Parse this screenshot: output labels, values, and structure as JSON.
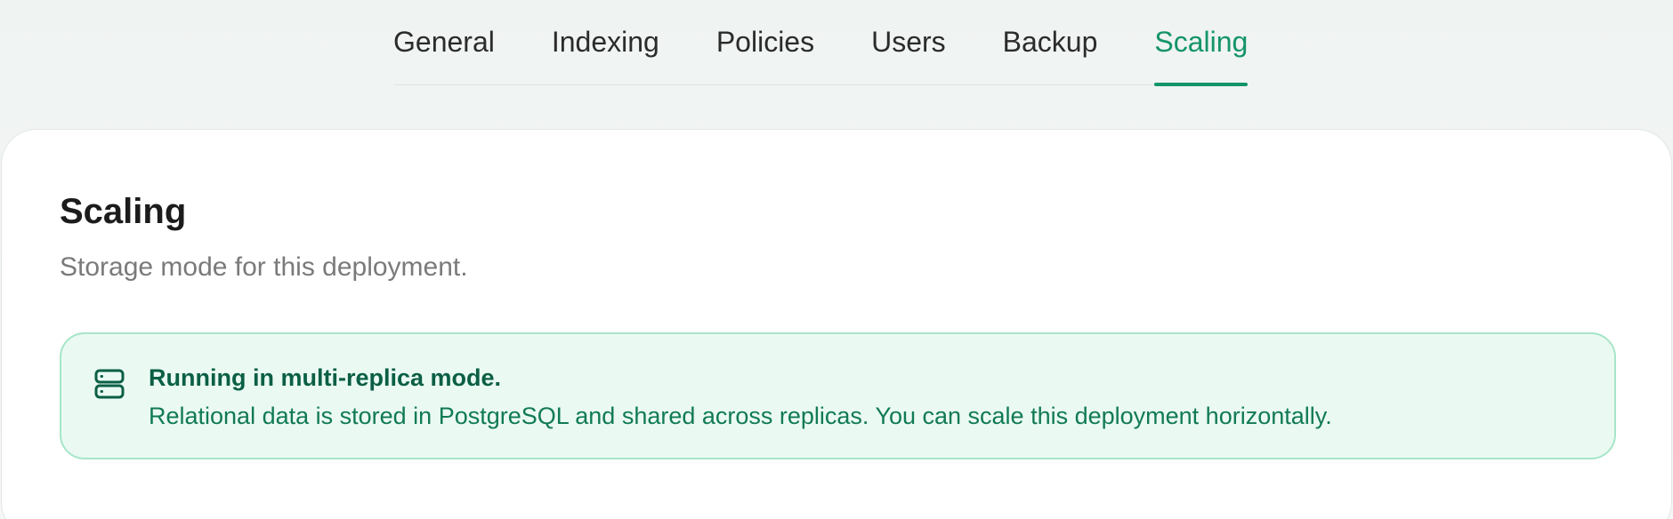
{
  "tabs": [
    {
      "label": "General"
    },
    {
      "label": "Indexing"
    },
    {
      "label": "Policies"
    },
    {
      "label": "Users"
    },
    {
      "label": "Backup"
    },
    {
      "label": "Scaling",
      "active": true
    }
  ],
  "panel": {
    "title": "Scaling",
    "subtitle": "Storage mode for this deployment."
  },
  "notice": {
    "icon": "server-icon",
    "title": "Running in multi-replica mode.",
    "body": "Relational data is stored in PostgreSQL and shared across replicas. You can scale this deployment horizontally."
  },
  "colors": {
    "accent": "#14946a",
    "notice_bg": "#eafaf2",
    "notice_border": "#a7e5c8",
    "notice_text": "#0b5f45"
  }
}
